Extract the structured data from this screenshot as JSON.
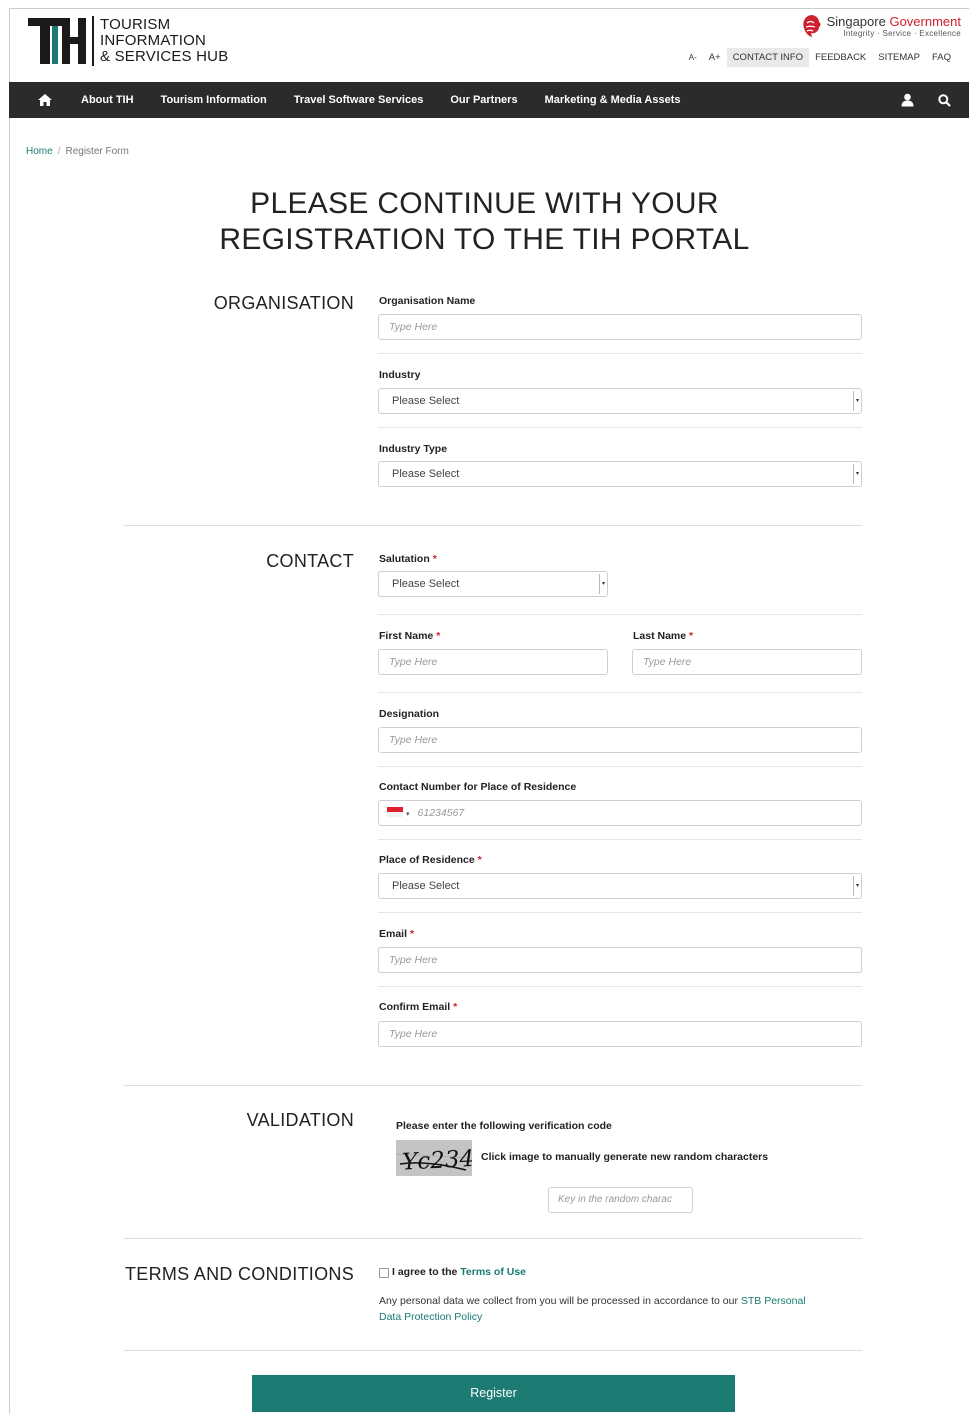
{
  "header": {
    "logo_mark": "TIH",
    "logo_lines": [
      "TOURISM",
      "INFORMATION",
      "& SERVICES HUB"
    ],
    "gov_name_1": "Singapore ",
    "gov_name_2": "Government",
    "gov_tagline": "Integrity · Service · Excellence",
    "font_decrease": "A-",
    "font_increase": "A+",
    "top_links": [
      "CONTACT INFO",
      "FEEDBACK",
      "SITEMAP",
      "FAQ"
    ]
  },
  "nav": {
    "items": [
      "About TIH",
      "Tourism Information",
      "Travel Software Services",
      "Our Partners",
      "Marketing & Media Assets"
    ],
    "icons": [
      "home-icon",
      "user-icon",
      "search-icon"
    ]
  },
  "breadcrumb": {
    "home": "Home",
    "separator": "/",
    "current": "Register Form"
  },
  "title": {
    "line1": "PLEASE CONTINUE WITH YOUR",
    "line2": "REGISTRATION TO THE TIH PORTAL"
  },
  "organisation": {
    "heading": "ORGANISATION",
    "org_name_label": "Organisation Name",
    "org_name_placeholder": "Type Here",
    "industry_label": "Industry",
    "industry_value": "Please Select",
    "industry_type_label": "Industry Type",
    "industry_type_value": "Please Select"
  },
  "contact": {
    "heading": "CONTACT",
    "required_mark": "*",
    "salutation_label": "Salutation",
    "salutation_value": "Please Select",
    "first_name_label": "First Name",
    "first_name_placeholder": "Type Here",
    "last_name_label": "Last Name",
    "last_name_placeholder": "Type Here",
    "designation_label": "Designation",
    "designation_placeholder": "Type Here",
    "phone_label": "Contact Number for Place of Residence",
    "phone_placeholder": "61234567",
    "residence_label": "Place of Residence",
    "residence_value": "Please Select",
    "email_label": "Email",
    "email_placeholder": "Type Here",
    "confirm_email_label": "Confirm Email",
    "confirm_email_placeholder": "Type Here"
  },
  "validation": {
    "heading": "VALIDATION",
    "instruction": "Please enter the following verification code",
    "captcha_text": "Yc234",
    "captcha_hint": "Click image to manually generate new random characters",
    "input_placeholder": "Key in the random charac"
  },
  "terms": {
    "heading": "TERMS AND CONDITIONS",
    "agree_prefix": "I agree to the ",
    "agree_link": "Terms of Use",
    "notice_prefix": "Any personal data we collect from you will be processed in accordance to our ",
    "notice_link_1": "STB Personal",
    "notice_link_2": "Data Protection Policy"
  },
  "register_button": "Register",
  "colors": {
    "brand_teal": "#1c7c74",
    "nav_bg": "#2b2b2b",
    "required_red": "#d0202e",
    "gov_red": "#d0202e"
  }
}
